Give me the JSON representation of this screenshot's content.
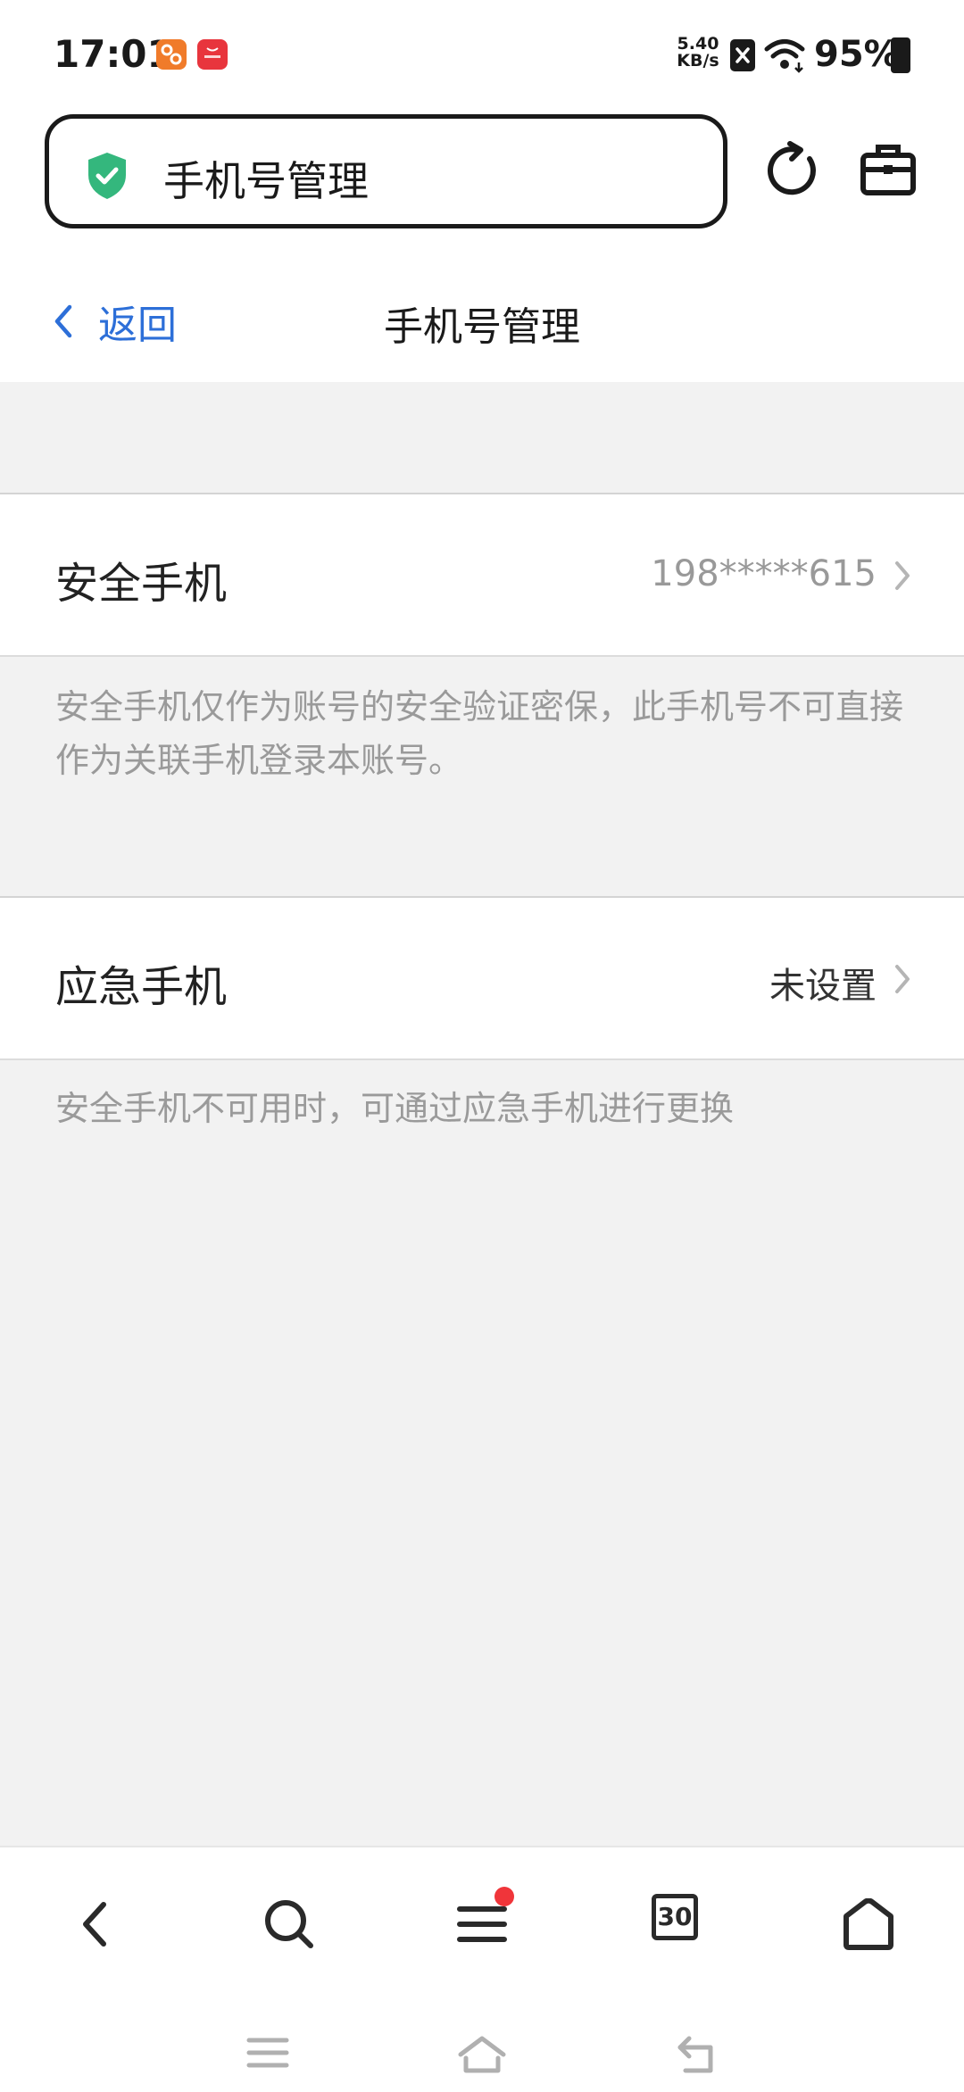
{
  "status_bar": {
    "time": "17:01",
    "net_speed_value": "5.40",
    "net_speed_unit": "KB/s",
    "battery": "95%",
    "icons": [
      "app-icon-orange",
      "huawei-app-icon",
      "sim-x-icon",
      "wifi-icon",
      "battery-icon"
    ]
  },
  "browser": {
    "address_text": "手机号管理",
    "secure_icon": "shield-check-icon",
    "actions": [
      "refresh-icon",
      "toolbox-icon"
    ]
  },
  "header": {
    "back_label": "返回",
    "title": "手机号管理"
  },
  "security_phone": {
    "label": "安全手机",
    "value": "198*****615",
    "description": "安全手机仅作为账号的安全验证密保，此手机号不可直接作为关联手机登录本账号。"
  },
  "emergency_phone": {
    "label": "应急手机",
    "value": "未设置",
    "description": "安全手机不可用时，可通过应急手机进行更换"
  },
  "bottom_nav": {
    "tab_count": "30",
    "items": [
      "back-icon",
      "search-icon",
      "menu-icon",
      "tabs-icon",
      "home-icon"
    ]
  },
  "colors": {
    "link_blue": "#2d6fd8",
    "shield_green": "#34b77d",
    "badge_red": "#f0353a",
    "background": "#f2f2f2"
  }
}
